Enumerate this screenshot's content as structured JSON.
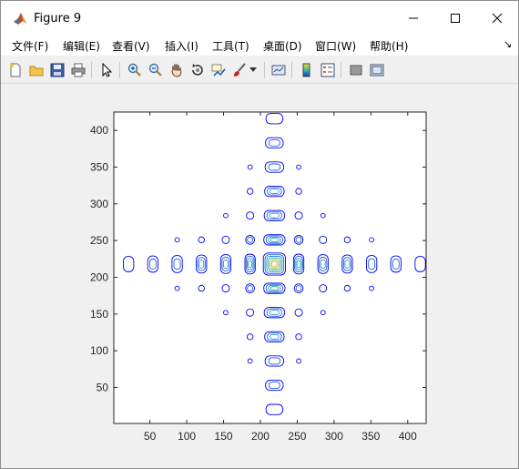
{
  "window": {
    "title": "Figure 9"
  },
  "menu": {
    "items": [
      "文件(F)",
      "编辑(E)",
      "查看(V)",
      "插入(I)",
      "工具(T)",
      "桌面(D)",
      "窗口(W)",
      "帮助(H)"
    ],
    "overflow_glyph": "↘"
  },
  "toolbar": {
    "buttons": [
      "new-figure-icon",
      "open-file-icon",
      "save-icon",
      "print-icon",
      "pointer-icon",
      "zoom-in-icon",
      "zoom-out-icon",
      "pan-hand-icon",
      "rotate-3d-icon",
      "data-cursor-icon",
      "brush-icon",
      "dropdown-arrow-icon",
      "link-plot-icon",
      "colorbar-icon",
      "legend-icon",
      "hide-plot-tools-icon",
      "show-plot-tools-icon"
    ]
  },
  "chart_data": {
    "type": "contour",
    "x_ticks": [
      50,
      100,
      150,
      200,
      250,
      300,
      350,
      400
    ],
    "y_ticks": [
      50,
      100,
      150,
      200,
      250,
      300,
      350,
      400
    ],
    "xlim": [
      1,
      425
    ],
    "ylim": [
      1,
      425
    ],
    "center": [
      219,
      218
    ],
    "peak_period": 33,
    "note_levels_colors": [
      "#0000ff",
      "#1f5fd0",
      "#2e8fd8",
      "#22a8a8",
      "#7fbf3f",
      "#e0a020"
    ],
    "grid": false,
    "legend": "none"
  }
}
